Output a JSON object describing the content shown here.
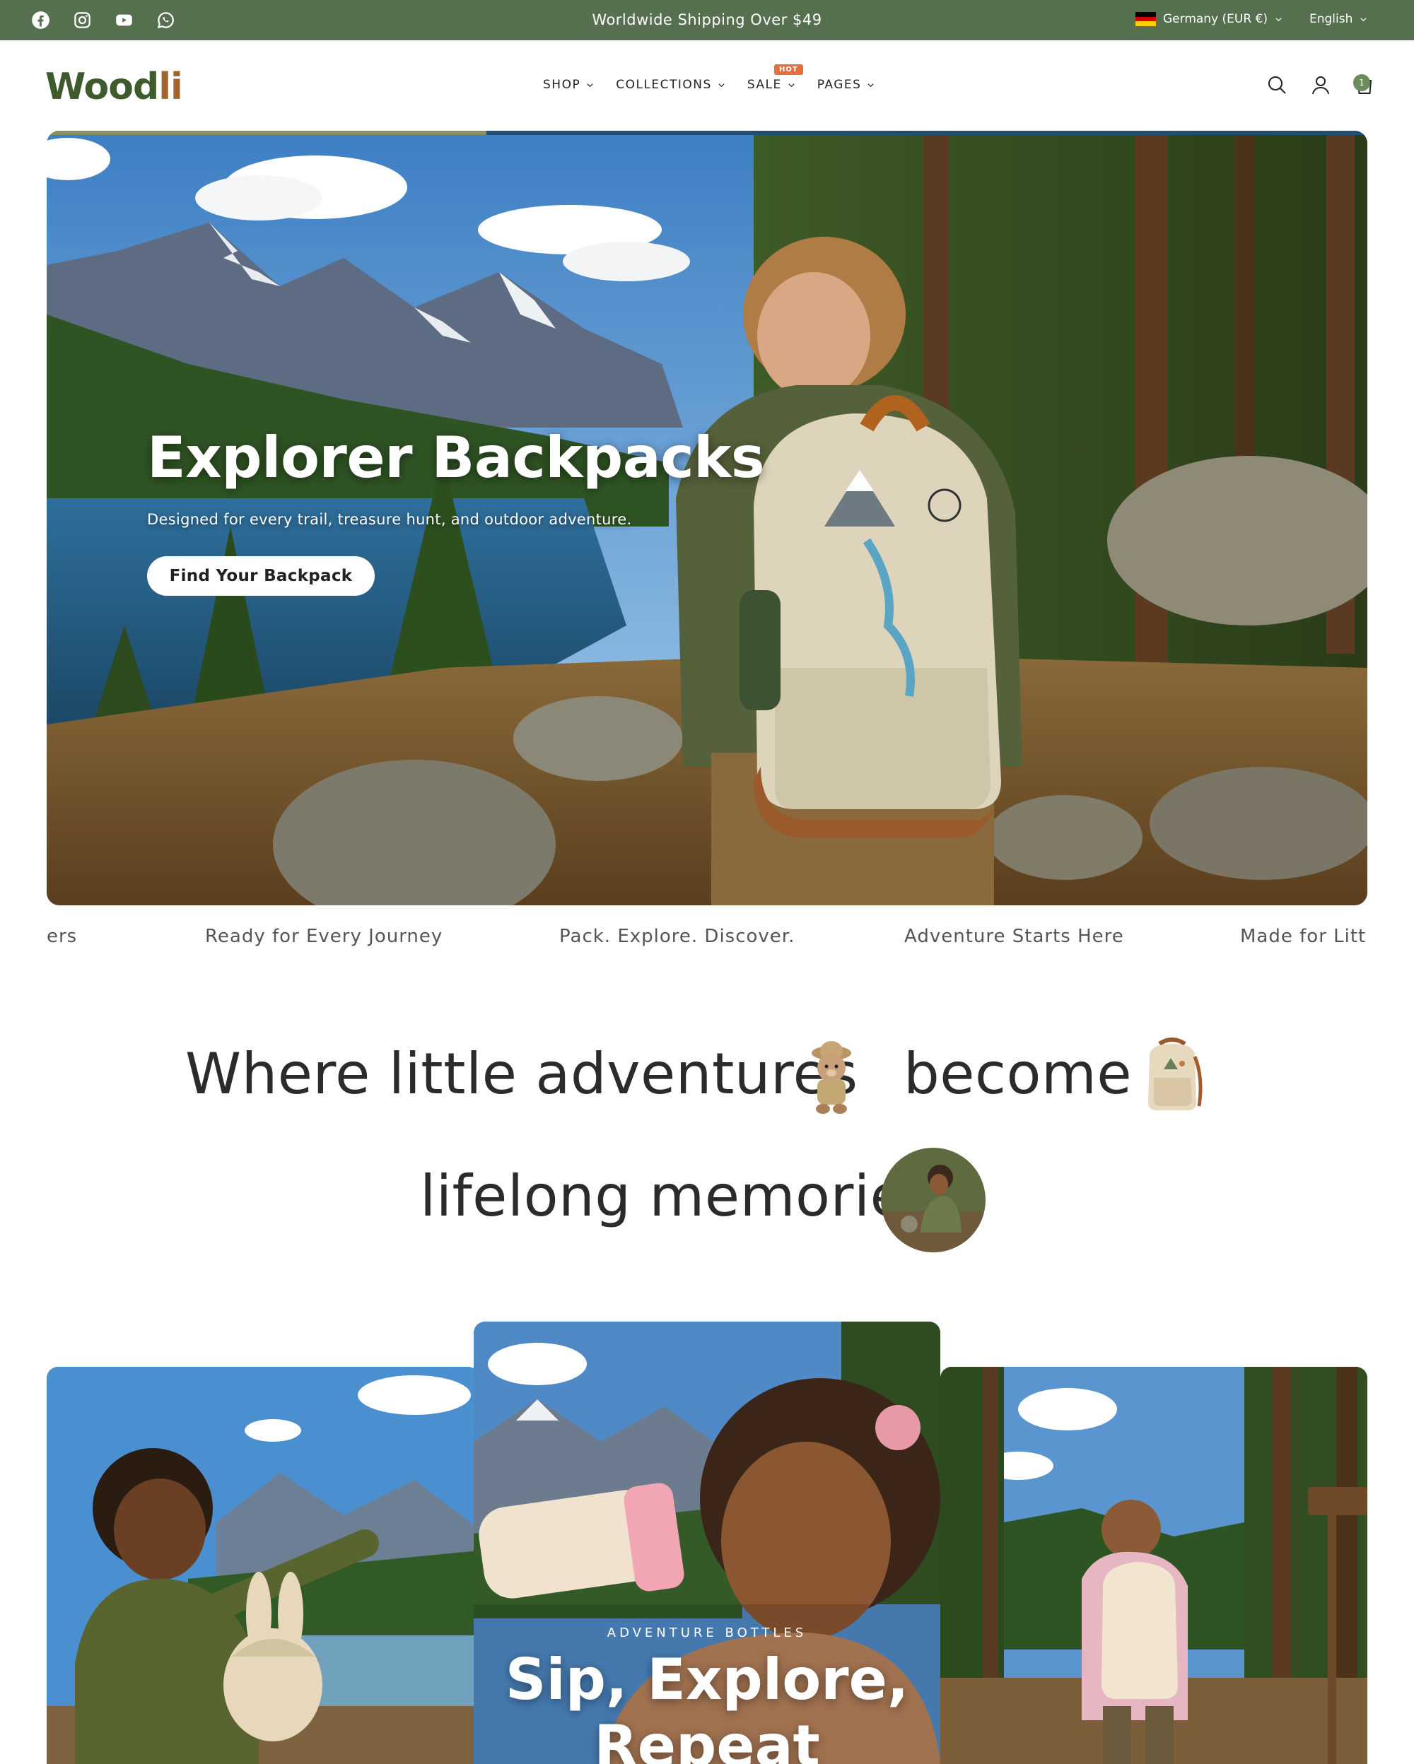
{
  "announcement_bar": {
    "text": "Worldwide Shipping Over $49",
    "social_icons": [
      "facebook-icon",
      "instagram-icon",
      "youtube-icon",
      "whatsapp-icon"
    ],
    "country_selector": "Germany (EUR €)",
    "language_selector": "English",
    "background": "#556f4f"
  },
  "header": {
    "logo_main": "Wood",
    "logo_accent": "li",
    "nav": [
      {
        "label": "SHOP"
      },
      {
        "label": "COLLECTIONS"
      },
      {
        "label": "SALE",
        "badge": "HOT"
      },
      {
        "label": "PAGES"
      }
    ],
    "icons": [
      "search-icon",
      "account-icon",
      "cart-icon"
    ],
    "cart_count": "1"
  },
  "hero": {
    "title": "Explorer Backpacks",
    "subtitle": "Designed for every trail, treasure hunt, and outdoor adventure.",
    "button": "Find Your Backpack",
    "slide_progress": 0.333
  },
  "marquee": {
    "items": [
      "ers",
      "Ready for Every Journey",
      "Pack. Explore. Discover.",
      "Adventure Starts Here",
      "Made for Little"
    ]
  },
  "intro": {
    "line1_a": "Where little adventures",
    "line1_b": "become",
    "line2": "lifelong memories"
  },
  "collections": {
    "center_card": {
      "eyebrow": "ADVENTURE BOTTLES",
      "title_line1": "Sip, Explore,",
      "title_line2": "Repeat"
    }
  },
  "colors": {
    "brand_green": "#3f5a2c",
    "brand_brown": "#a3642b",
    "hot_badge": "#e56f3b"
  }
}
